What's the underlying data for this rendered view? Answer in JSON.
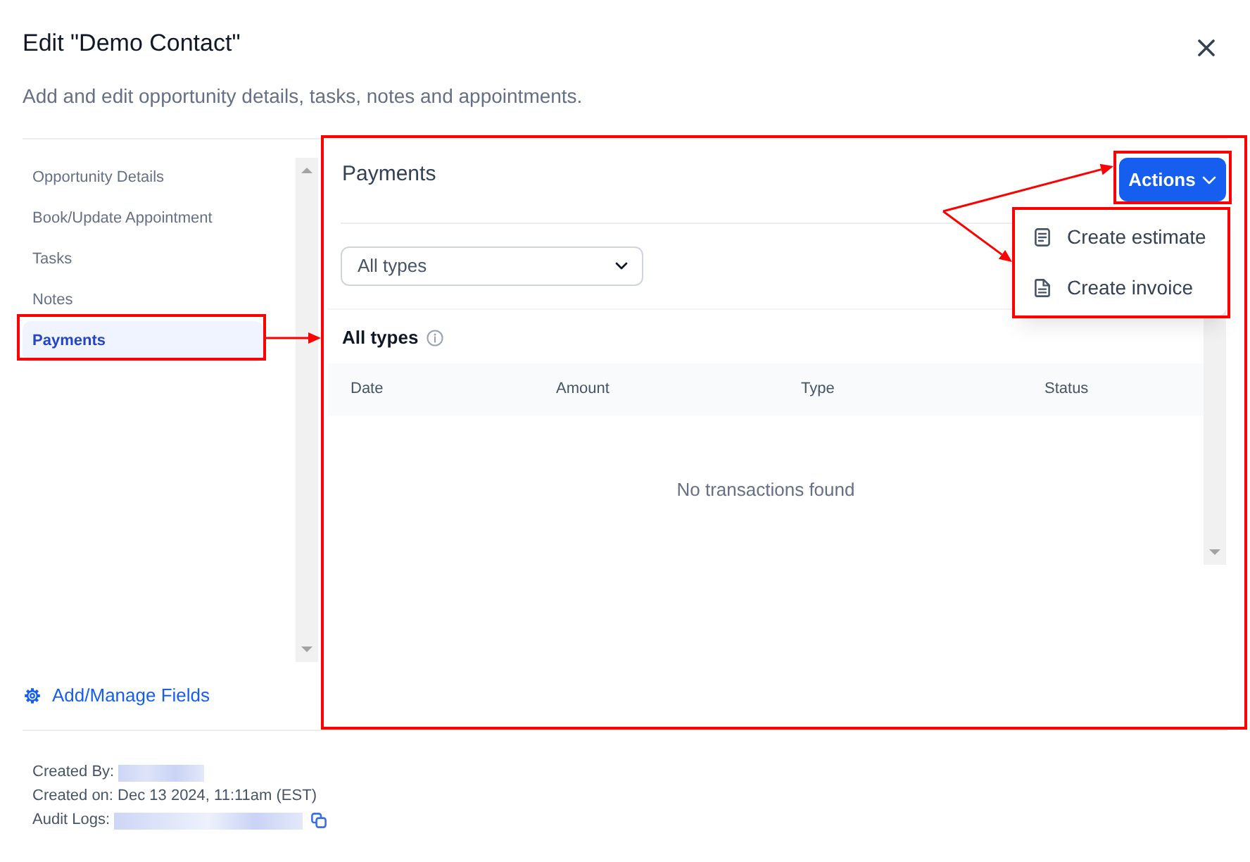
{
  "dialog": {
    "title": "Edit \"Demo Contact\"",
    "subtitle": "Add and edit opportunity details, tasks, notes and appointments."
  },
  "sidebar": {
    "items": [
      {
        "label": "Opportunity Details",
        "selected": false
      },
      {
        "label": "Book/Update Appointment",
        "selected": false
      },
      {
        "label": "Tasks",
        "selected": false
      },
      {
        "label": "Notes",
        "selected": false
      },
      {
        "label": "Payments",
        "selected": true
      }
    ],
    "manage_link": "Add/Manage Fields"
  },
  "payments": {
    "title": "Payments",
    "actions_button": "Actions",
    "actions_menu": {
      "open": true,
      "items": [
        {
          "kind": "estimate",
          "label": "Create estimate"
        },
        {
          "kind": "invoice",
          "label": "Create invoice"
        }
      ]
    },
    "filter": {
      "value": "All types"
    },
    "section_title": "All types",
    "table": {
      "columns": [
        "Date",
        "Amount",
        "Type",
        "Status"
      ],
      "empty_message": "No transactions found"
    }
  },
  "footer": {
    "lines": [
      {
        "kind": "redacted",
        "label": "Created By:"
      },
      {
        "kind": "text",
        "label": "Created on: Dec 13 2024, 11:11am (EST)"
      },
      {
        "kind": "redacted_copy",
        "label": "Audit Logs:"
      }
    ]
  }
}
